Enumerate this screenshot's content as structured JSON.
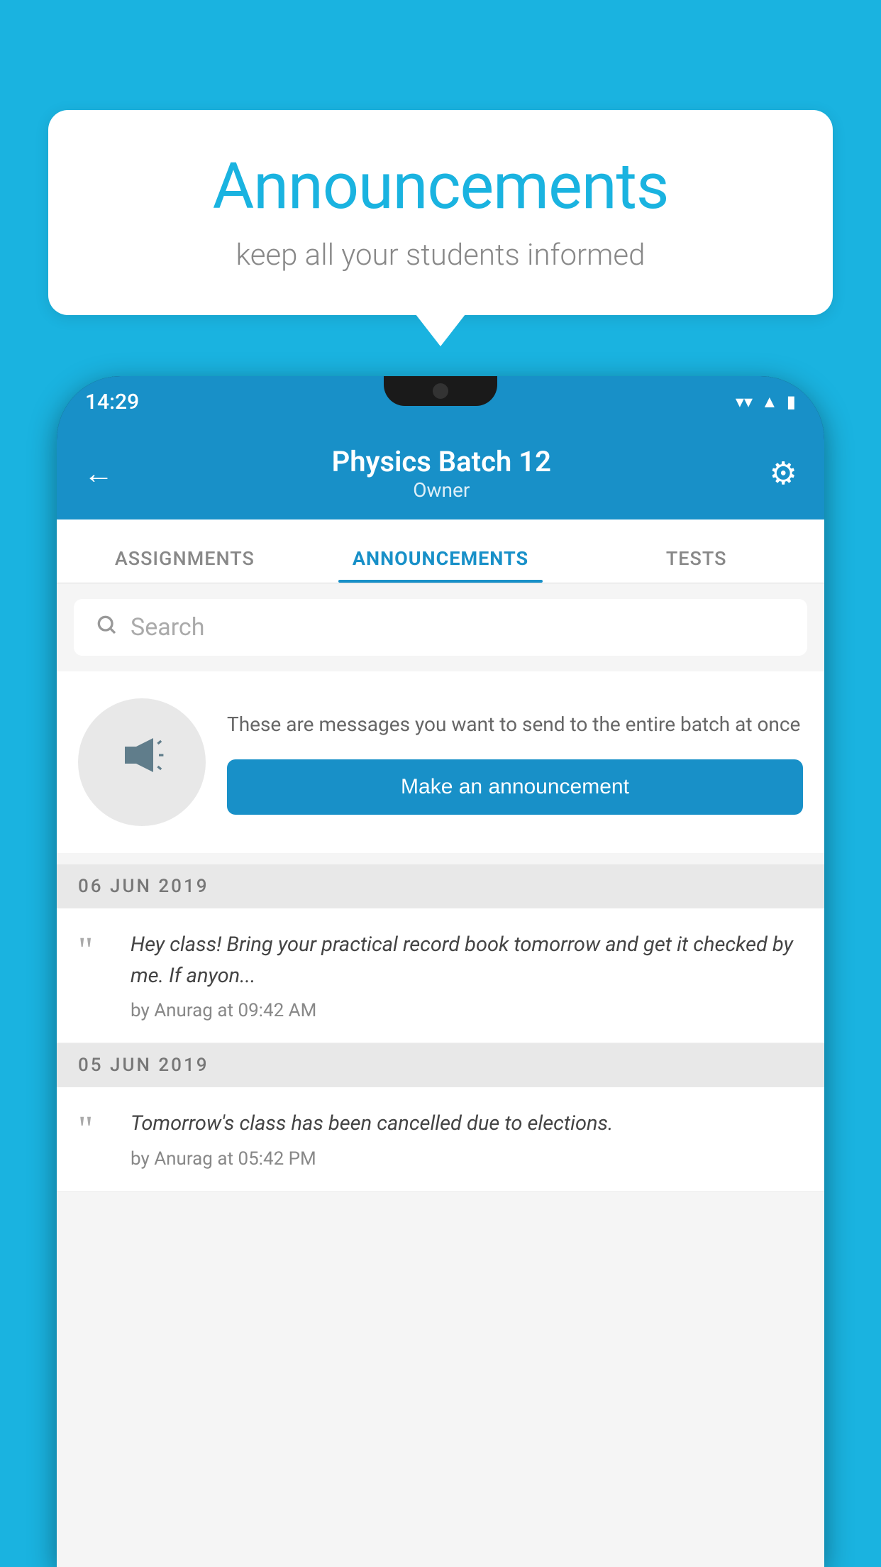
{
  "background_color": "#1ab3e0",
  "bubble": {
    "title": "Announcements",
    "subtitle": "keep all your students informed"
  },
  "status_bar": {
    "time": "14:29",
    "icons": [
      "wifi",
      "signal",
      "battery"
    ]
  },
  "header": {
    "title": "Physics Batch 12",
    "subtitle": "Owner",
    "back_label": "←",
    "gear_label": "⚙"
  },
  "tabs": [
    {
      "label": "ASSIGNMENTS",
      "active": false
    },
    {
      "label": "ANNOUNCEMENTS",
      "active": true
    },
    {
      "label": "TESTS",
      "active": false
    }
  ],
  "search": {
    "placeholder": "Search"
  },
  "announcement_card": {
    "description": "These are messages you want to send to the entire batch at once",
    "button_label": "Make an announcement"
  },
  "messages": [
    {
      "date": "06  JUN  2019",
      "text": "Hey class! Bring your practical record book tomorrow and get it checked by me. If anyon...",
      "author": "by Anurag at 09:42 AM"
    },
    {
      "date": "05  JUN  2019",
      "text": "Tomorrow's class has been cancelled due to elections.",
      "author": "by Anurag at 05:42 PM"
    }
  ]
}
